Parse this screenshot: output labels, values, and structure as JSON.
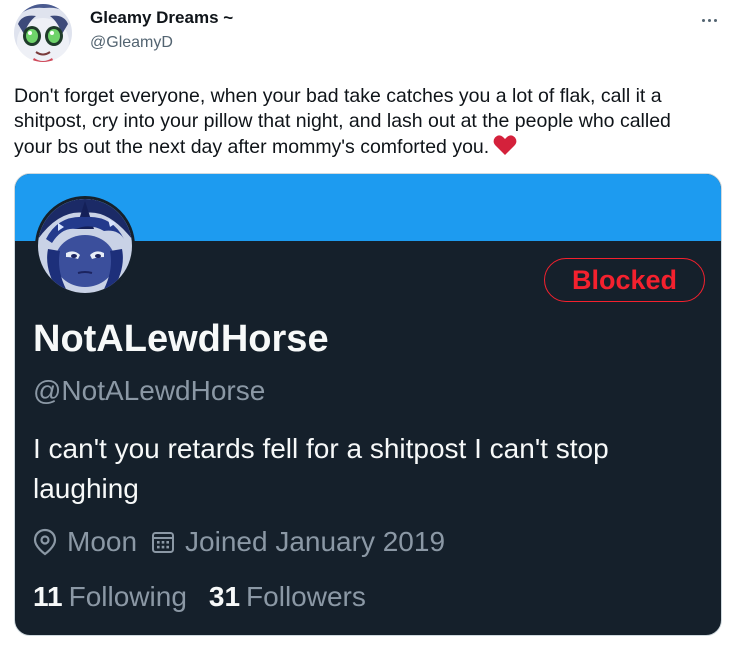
{
  "author": {
    "name": "Gleamy Dreams ~",
    "handle": "@GleamyD",
    "avatar_icon": "pony-avatar-icon"
  },
  "more_icon": "more-horizontal-icon",
  "tweet": {
    "text": "Don't forget everyone, when your bad take catches you a lot of flak, call it a shitpost, cry into your pillow that night, and lash out at the people who called your bs out the next day after mommy's comforted you.",
    "emoji": "heart-icon"
  },
  "card": {
    "banner_color": "#1d9bf0",
    "avatar_icon": "pony-avatar-icon",
    "blocked_label": "Blocked",
    "name": "NotALewdHorse",
    "handle": "@NotALewdHorse",
    "bio": "I can't you retards fell for a shitpost I can't stop laughing",
    "location_icon": "location-pin-icon",
    "location": "Moon",
    "joined_icon": "calendar-icon",
    "joined": "Joined January 2019",
    "following_count": "11",
    "following_label": "Following",
    "followers_count": "31",
    "followers_label": "Followers"
  },
  "colors": {
    "card_background": "#15202b",
    "blocked": "#f4212e",
    "heart": "#d4213b"
  }
}
